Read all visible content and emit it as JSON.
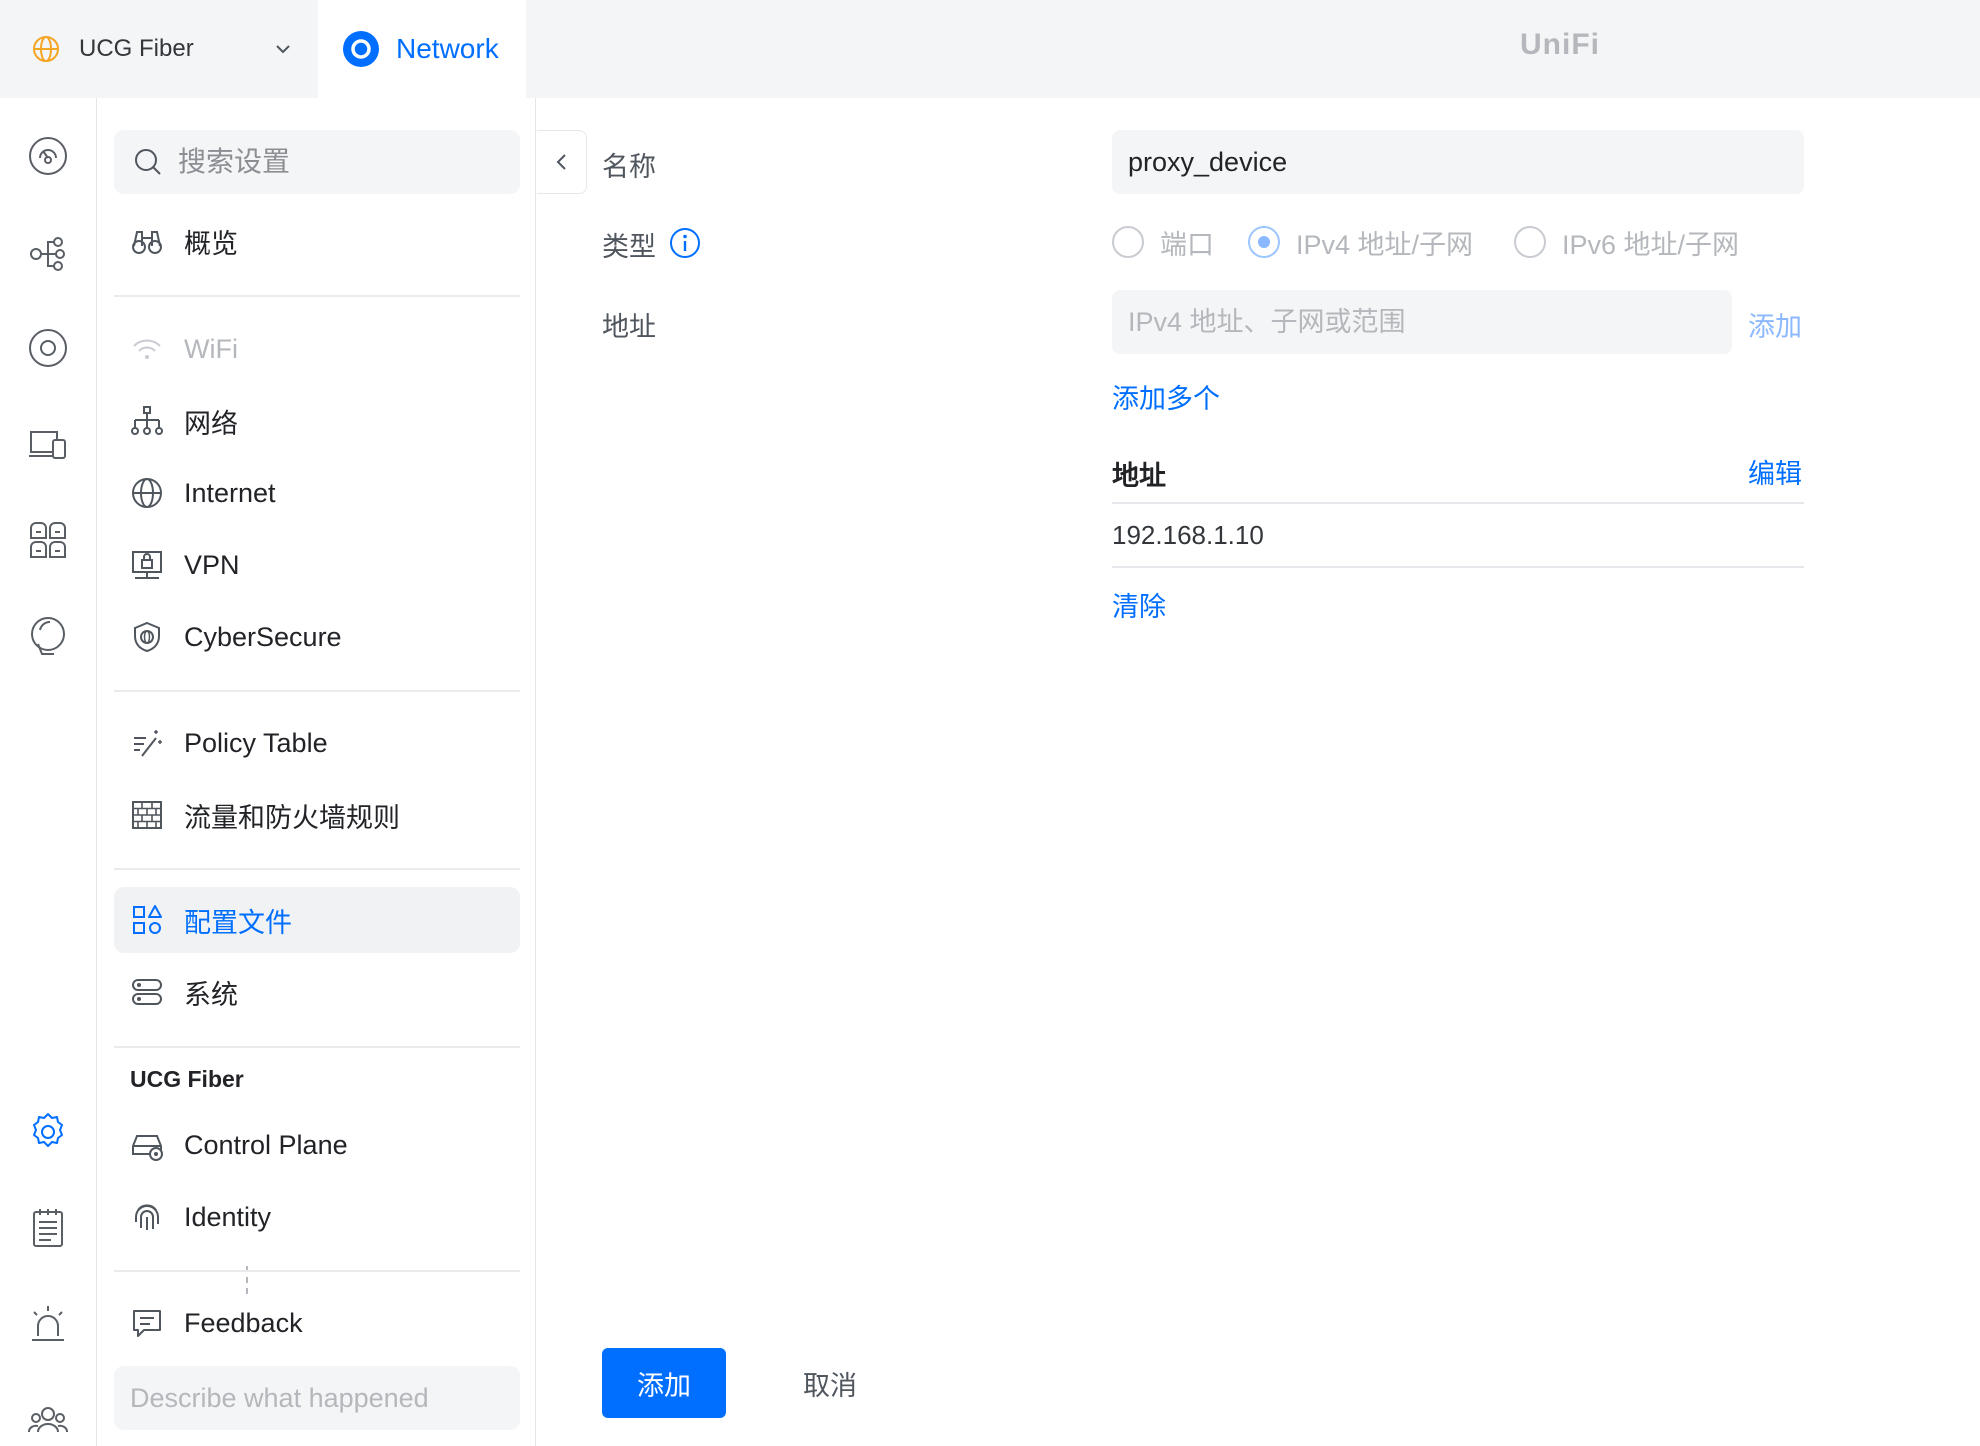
{
  "topbar": {
    "site_name": "UCG Fiber",
    "app_name": "Network",
    "brand": "UniFi"
  },
  "rail": {
    "icons": [
      "dashboard-icon",
      "topology-icon",
      "devices-icon",
      "clients-icon",
      "insights-icon",
      "innerspace-icon",
      "settings-icon",
      "logs-icon",
      "alarm-icon",
      "admins-icon"
    ]
  },
  "nav": {
    "search_placeholder": "搜索设置",
    "items": {
      "overview": "概览",
      "wifi": "WiFi",
      "networks": "网络",
      "internet": "Internet",
      "vpn": "VPN",
      "cybersecure": "CyberSecure",
      "policy_table": "Policy Table",
      "firewall": "流量和防火墙规则",
      "profiles": "配置文件",
      "system": "系统"
    },
    "group_title": "UCG Fiber",
    "group_items": {
      "control_plane": "Control Plane",
      "identity": "Identity"
    },
    "feedback_label": "Feedback",
    "feedback_placeholder": "Describe what happened"
  },
  "form": {
    "name_label": "名称",
    "name_value": "proxy_device",
    "type_label": "类型",
    "type_options": {
      "port": "端口",
      "ipv4": "IPv4 地址/子网",
      "ipv6": "IPv6 地址/子网"
    },
    "type_selected": "ipv4",
    "address_label": "地址",
    "address_placeholder": "IPv4 地址、子网或范围",
    "add_link": "添加",
    "add_multiple": "添加多个",
    "list_header": "地址",
    "edit_link": "编辑",
    "addresses": [
      "192.168.1.10"
    ],
    "clear_link": "清除"
  },
  "footer": {
    "submit_label": "添加",
    "cancel_label": "取消"
  },
  "colors": {
    "accent": "#006fff",
    "accent_muted": "#8bb8ff",
    "site_icon": "#f5a524"
  }
}
